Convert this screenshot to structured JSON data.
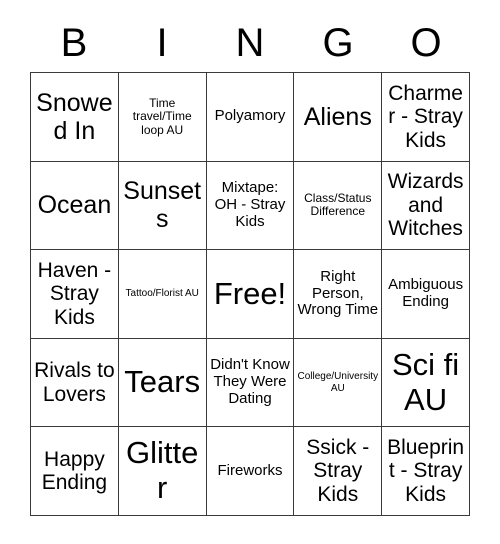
{
  "header": {
    "letters": [
      "B",
      "I",
      "N",
      "G",
      "O"
    ]
  },
  "grid": {
    "columns": 5,
    "rows": 5,
    "cells": [
      {
        "text": "Snowed In",
        "size": "xl"
      },
      {
        "text": "Time travel/Time loop AU",
        "size": "sm"
      },
      {
        "text": "Polyamory",
        "size": "md"
      },
      {
        "text": "Aliens",
        "size": "xl"
      },
      {
        "text": "Charmer - Stray Kids",
        "size": "lg"
      },
      {
        "text": "Ocean",
        "size": "xl"
      },
      {
        "text": "Sunsets",
        "size": "xl"
      },
      {
        "text": "Mixtape: OH - Stray Kids",
        "size": "md"
      },
      {
        "text": "Class/Status Difference",
        "size": "sm"
      },
      {
        "text": "Wizards and Witches",
        "size": "lg"
      },
      {
        "text": "Haven - Stray Kids",
        "size": "lg"
      },
      {
        "text": "Tattoo/Florist AU",
        "size": "xs"
      },
      {
        "text": "Free!",
        "size": "xxl"
      },
      {
        "text": "Right Person, Wrong Time",
        "size": "md"
      },
      {
        "text": "Ambiguous Ending",
        "size": "md"
      },
      {
        "text": "Rivals to Lovers",
        "size": "lg"
      },
      {
        "text": "Tears",
        "size": "xxl"
      },
      {
        "text": "Didn't Know They Were Dating",
        "size": "md"
      },
      {
        "text": "College/University AU",
        "size": "xs"
      },
      {
        "text": "Sci fi AU",
        "size": "xxl"
      },
      {
        "text": "Happy Ending",
        "size": "lg"
      },
      {
        "text": "Glitter",
        "size": "xxl"
      },
      {
        "text": "Fireworks",
        "size": "md"
      },
      {
        "text": "Ssick - Stray Kids",
        "size": "lg"
      },
      {
        "text": "Blueprint - Stray Kids",
        "size": "lg"
      }
    ]
  },
  "colors": {
    "background": "#ffffff",
    "text": "#000000",
    "border": "#3a3a3a"
  }
}
